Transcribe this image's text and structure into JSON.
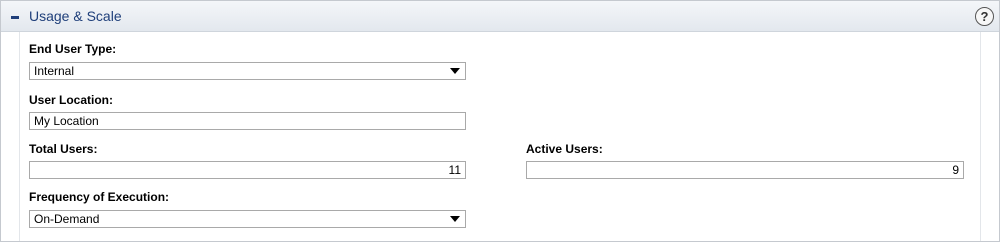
{
  "panel": {
    "title": "Usage & Scale",
    "collapse_glyph": "−",
    "help_glyph": "?"
  },
  "form": {
    "end_user_type": {
      "label": "End User Type:",
      "value": "Internal"
    },
    "user_location": {
      "label": "User Location:",
      "value": "My Location"
    },
    "total_users": {
      "label": "Total Users:",
      "value": "11"
    },
    "active_users": {
      "label": "Active Users:",
      "value": "9"
    },
    "frequency": {
      "label": "Frequency of Execution:",
      "value": "On-Demand"
    }
  },
  "icons": {
    "collapse": "minus-icon",
    "help": "help-icon",
    "dropdown": "chevron-down-icon"
  }
}
